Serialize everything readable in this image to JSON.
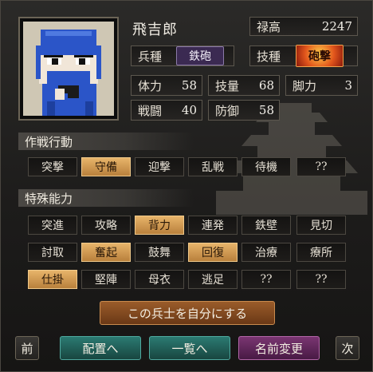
{
  "unit": {
    "name": "飛吉郎",
    "stipend_label": "禄高",
    "stipend_value": "2247",
    "troop_type_label": "兵種",
    "troop_type_value": "鉄砲",
    "technique_label": "技種",
    "technique_value": "砲撃"
  },
  "stats": [
    {
      "label": "体力",
      "value": "58"
    },
    {
      "label": "技量",
      "value": "68"
    },
    {
      "label": "脚力",
      "value": "3"
    },
    {
      "label": "戦闘",
      "value": "40"
    },
    {
      "label": "防御",
      "value": "58"
    }
  ],
  "tactics": {
    "title": "作戦行動",
    "items": [
      {
        "label": "突撃",
        "active": false
      },
      {
        "label": "守備",
        "active": true
      },
      {
        "label": "迎撃",
        "active": false
      },
      {
        "label": "乱戦",
        "active": false
      },
      {
        "label": "待機",
        "active": false
      },
      {
        "label": "??",
        "active": false
      }
    ]
  },
  "abilities": {
    "title": "特殊能力",
    "items": [
      {
        "label": "突進",
        "active": false
      },
      {
        "label": "攻略",
        "active": false
      },
      {
        "label": "背力",
        "active": true
      },
      {
        "label": "連発",
        "active": false
      },
      {
        "label": "鉄壁",
        "active": false
      },
      {
        "label": "見切",
        "active": false
      },
      {
        "label": "討取",
        "active": false
      },
      {
        "label": "奮起",
        "active": true
      },
      {
        "label": "鼓舞",
        "active": false
      },
      {
        "label": "回復",
        "active": true
      },
      {
        "label": "治療",
        "active": false
      },
      {
        "label": "療所",
        "active": false
      },
      {
        "label": "仕掛",
        "active": true
      },
      {
        "label": "堅陣",
        "active": false
      },
      {
        "label": "母衣",
        "active": false
      },
      {
        "label": "逃足",
        "active": false
      },
      {
        "label": "??",
        "active": false
      },
      {
        "label": "??",
        "active": false
      }
    ]
  },
  "actions": {
    "make_own": "この兵士を自分にする",
    "prev": "前",
    "place": "配置へ",
    "list": "一覧へ",
    "rename": "名前変更",
    "next": "次"
  },
  "colors": {
    "active_fill": "#d49b52",
    "troop_type_fill": "#3b2a52",
    "technique_fill": "#d13a1c",
    "place_btn": "#1f5a55",
    "list_btn": "#1f5a55",
    "rename_btn": "#5a2550",
    "make_own_btn": "#7a4820"
  }
}
